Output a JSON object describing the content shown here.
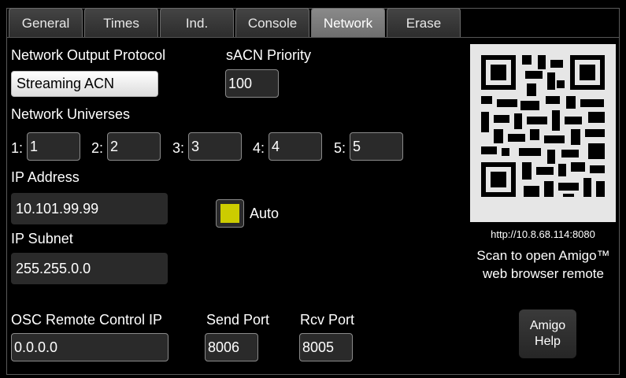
{
  "tabs": [
    "General",
    "Times",
    "Ind.",
    "Console",
    "Network",
    "Erase"
  ],
  "active_tab": "Network",
  "protocol": {
    "label": "Network Output Protocol",
    "value": "Streaming ACN"
  },
  "priority": {
    "label": "sACN Priority",
    "value": "100"
  },
  "universes": {
    "label": "Network Universes",
    "items": [
      {
        "label": "1:",
        "value": "1"
      },
      {
        "label": "2:",
        "value": "2"
      },
      {
        "label": "3:",
        "value": "3"
      },
      {
        "label": "4:",
        "value": "4"
      },
      {
        "label": "5:",
        "value": "5"
      }
    ]
  },
  "ip_address": {
    "label": "IP Address",
    "value": "10.101.99.99"
  },
  "auto": {
    "label": "Auto",
    "checked": true,
    "color": "#cccc00"
  },
  "ip_subnet": {
    "label": "IP Subnet",
    "value": "255.255.0.0"
  },
  "qr": {
    "url": "http://10.8.68.114:8080",
    "caption_line1": "Scan to open Amigo™",
    "caption_line2": "web browser remote"
  },
  "osc": {
    "label": "OSC Remote Control IP",
    "value": "0.0.0.0",
    "send_label": "Send Port",
    "send_value": "8006",
    "rcv_label": "Rcv Port",
    "rcv_value": "8005"
  },
  "help": {
    "line1": "Amigo",
    "line2": "Help"
  }
}
